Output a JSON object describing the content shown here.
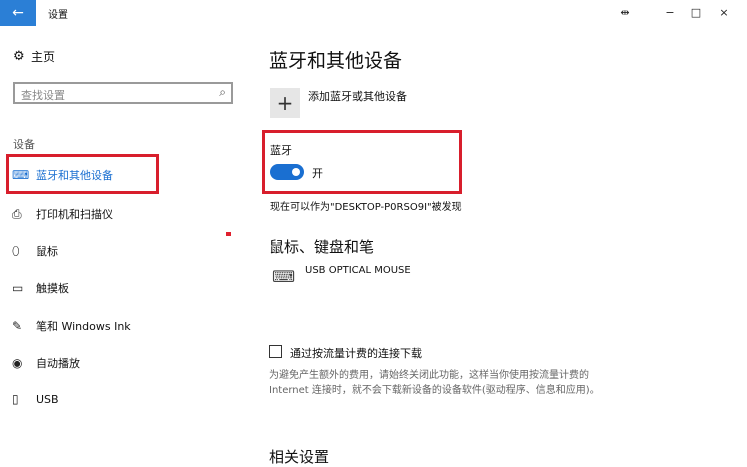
{
  "window": {
    "title": "设置",
    "controls": [
      "−",
      "□",
      "×"
    ],
    "back_icon": "arrow-left-icon"
  },
  "sidebar": {
    "home_label": "主页",
    "search_placeholder": "查找设置",
    "group_label": "设备",
    "items": [
      {
        "label": "蓝牙和其他设备",
        "icon": "bluetooth-devices-icon",
        "active": true
      },
      {
        "label": "打印机和扫描仪",
        "icon": "printer-icon",
        "active": false
      },
      {
        "label": "鼠标",
        "icon": "mouse-icon",
        "active": false
      },
      {
        "label": "触摸板",
        "icon": "touchpad-icon",
        "active": false
      },
      {
        "label": "笔和 Windows Ink",
        "icon": "pen-icon",
        "active": false
      },
      {
        "label": "自动播放",
        "icon": "autoplay-icon",
        "active": false
      },
      {
        "label": "USB",
        "icon": "usb-icon",
        "active": false
      }
    ]
  },
  "main": {
    "page_title": "蓝牙和其他设备",
    "add_device_label": "添加蓝牙或其他设备",
    "bluetooth_title": "蓝牙",
    "bluetooth_state": "开",
    "discoverable_text": "现在可以作为\"DESKTOP-P0RSO9I\"被发现",
    "section_mouse_keyboard": "鼠标、键盘和笔",
    "device_name": "USB OPTICAL MOUSE",
    "metered_label": "通过按流量计费的连接下载",
    "metered_description": "为避免产生额外的费用，请始终关闭此功能，这样当你使用按流量计费的 Internet 连接时，就不会下载新设备的设备软件(驱动程序、信息和应用)。",
    "related_settings": "相关设置"
  },
  "colors": {
    "accent": "#1a6fd1",
    "highlight_box": "#d81e2c"
  }
}
